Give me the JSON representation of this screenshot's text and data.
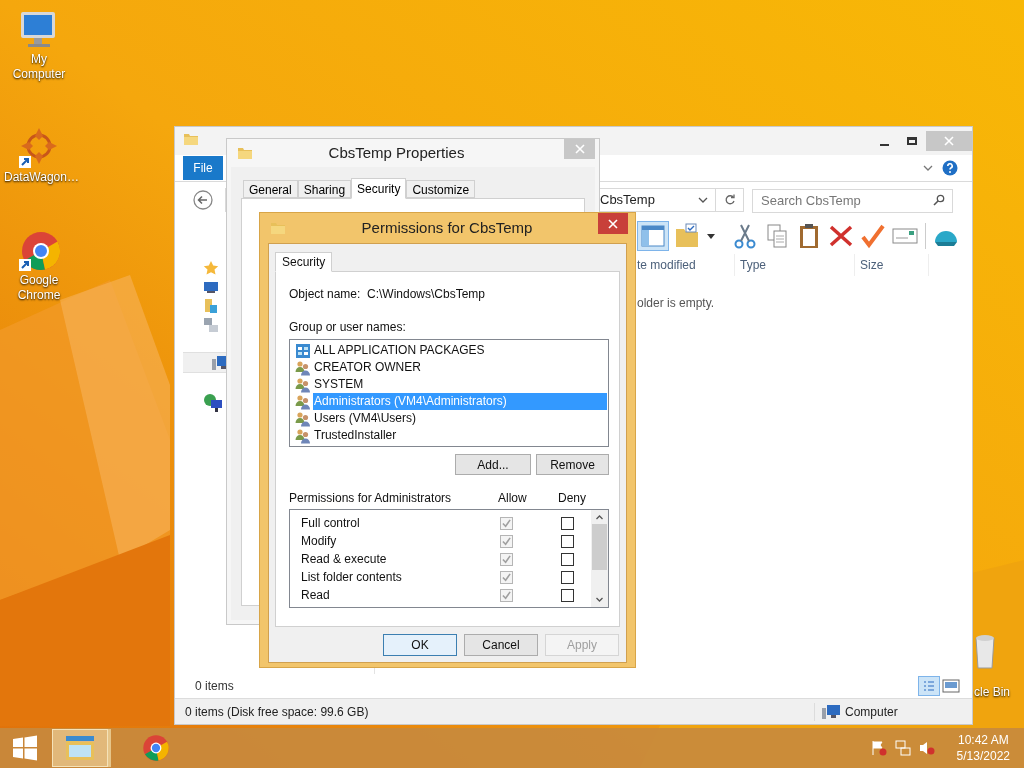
{
  "desktop": {
    "icons": [
      {
        "label": "My Computer",
        "kind": "computer"
      },
      {
        "label": "DataWagon…",
        "kind": "shortcut-app"
      },
      {
        "label": "Google Chrome",
        "kind": "chrome"
      }
    ],
    "recycle_bin": {
      "label": "cle Bin"
    }
  },
  "explorer": {
    "ribbon_tab": "File",
    "address": "CbsTemp",
    "search": {
      "placeholder": "Search CbsTemp"
    },
    "nav_items": [
      {
        "kind": "favorites",
        "selected": false
      },
      {
        "kind": "desktop",
        "selected": false
      },
      {
        "kind": "libraries",
        "selected": false
      },
      {
        "kind": "homegroup",
        "selected": false
      },
      {
        "kind": "computer",
        "selected": true
      },
      {
        "kind": "network",
        "selected": false
      }
    ],
    "columns": [
      "te modified",
      "Type",
      "Size"
    ],
    "empty_message": "older is empty.",
    "item_count": "0 items",
    "status_text": "0 items (Disk free space: 99.6 GB)",
    "status_location": "Computer"
  },
  "properties": {
    "title": "CbsTemp Properties",
    "tabs": [
      {
        "label": "General",
        "selected": false
      },
      {
        "label": "Sharing",
        "selected": false
      },
      {
        "label": "Security",
        "selected": true
      },
      {
        "label": "Customize",
        "selected": false
      }
    ]
  },
  "permissions": {
    "title": "Permissions for CbsTemp",
    "tabs": [
      {
        "label": "Security",
        "selected": true
      }
    ],
    "object_label": "Object name:",
    "object_value": "C:\\Windows\\CbsTemp",
    "groups_label": "Group or user names:",
    "principals": [
      {
        "name": "ALL APPLICATION PACKAGES",
        "kind": "package",
        "selected": false
      },
      {
        "name": "CREATOR OWNER",
        "kind": "group",
        "selected": false
      },
      {
        "name": "SYSTEM",
        "kind": "group",
        "selected": false
      },
      {
        "name": "Administrators (VM4\\Administrators)",
        "kind": "group",
        "selected": true
      },
      {
        "name": "Users (VM4\\Users)",
        "kind": "group",
        "selected": false
      },
      {
        "name": "TrustedInstaller",
        "kind": "group",
        "selected": false
      }
    ],
    "add_button": "Add...",
    "remove_button": "Remove",
    "permissions_label": "Permissions for Administrators",
    "allow_header": "Allow",
    "deny_header": "Deny",
    "entries": [
      {
        "name": "Full control",
        "allow": true,
        "deny": false,
        "inherited": true
      },
      {
        "name": "Modify",
        "allow": true,
        "deny": false,
        "inherited": true
      },
      {
        "name": "Read & execute",
        "allow": true,
        "deny": false,
        "inherited": true
      },
      {
        "name": "List folder contents",
        "allow": true,
        "deny": false,
        "inherited": true
      },
      {
        "name": "Read",
        "allow": true,
        "deny": false,
        "inherited": true
      }
    ],
    "buttons": [
      {
        "label": "OK",
        "default": true,
        "disabled": false
      },
      {
        "label": "Cancel",
        "default": false,
        "disabled": false
      },
      {
        "label": "Apply",
        "default": false,
        "disabled": true
      }
    ]
  },
  "taskbar": {
    "apps": [
      {
        "kind": "explorer",
        "active": true
      },
      {
        "kind": "chrome",
        "active": false
      }
    ],
    "time": "10:42 AM",
    "date": "5/13/2022"
  }
}
